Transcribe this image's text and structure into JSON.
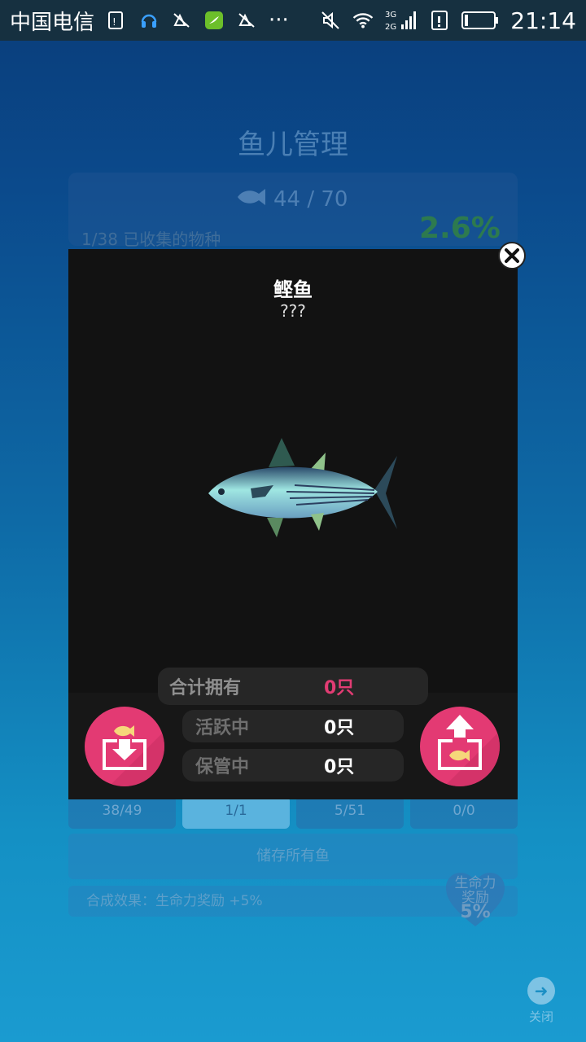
{
  "status_bar": {
    "carrier": "中国电信",
    "time": "21:14",
    "network_label": "3G 2G",
    "more_label": "···"
  },
  "background": {
    "title": "鱼儿管理",
    "fish_count": "44 / 70",
    "species_collected": "1/38 已收集的物种",
    "collection_percent": "2.6%",
    "tabs": [
      "38/49",
      "1/1",
      "5/51",
      "0/0"
    ],
    "store_all_label": "储存所有鱼",
    "effect_label": "合成效果：生命力奖励 +5%",
    "vitality_badge": {
      "label_line1": "生命力",
      "label_line2": "奖励",
      "value": "5%"
    },
    "close_label": "关闭"
  },
  "modal": {
    "fish_name": "鲣鱼",
    "fish_description": "???",
    "total_owned_label": "合计拥有",
    "total_owned_value": "0只",
    "active_label": "活跃中",
    "active_value": "0只",
    "stored_label": "保管中",
    "stored_value": "0只"
  },
  "colors": {
    "accent_pink": "#e33a73",
    "modal_bg": "#121212",
    "value_pink": "#e23c73"
  }
}
